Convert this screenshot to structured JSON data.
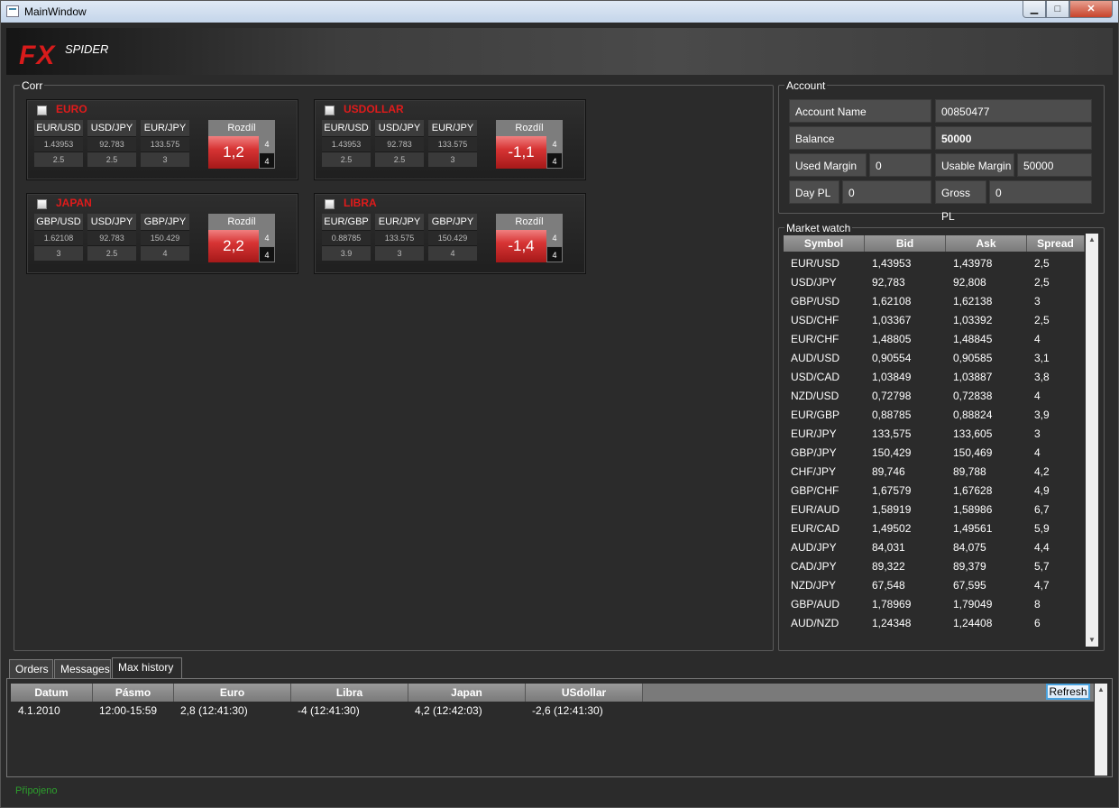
{
  "window": {
    "title": "MainWindow",
    "min_glyph": "▁",
    "max_glyph": "□",
    "close_glyph": "✕"
  },
  "header": {
    "logo_fx": "FX",
    "logo_spider": "SPIDER"
  },
  "corr": {
    "label": "Corr",
    "rozdil_label": "Rozdíl",
    "cards": [
      {
        "name": "EURO",
        "symbols": [
          "EUR/USD",
          "USD/JPY",
          "EUR/JPY"
        ],
        "values": [
          "1.43953",
          "92.783",
          "133.575"
        ],
        "spreads": [
          "2.5",
          "2.5",
          "3"
        ],
        "diff": "1,2",
        "diff_a": "4",
        "diff_b": "4"
      },
      {
        "name": "USDOLLAR",
        "symbols": [
          "EUR/USD",
          "USD/JPY",
          "EUR/JPY"
        ],
        "values": [
          "1.43953",
          "92.783",
          "133.575"
        ],
        "spreads": [
          "2.5",
          "2.5",
          "3"
        ],
        "diff": "-1,1",
        "diff_a": "4",
        "diff_b": "4"
      },
      {
        "name": "JAPAN",
        "symbols": [
          "GBP/USD",
          "USD/JPY",
          "GBP/JPY"
        ],
        "values": [
          "1.62108",
          "92.783",
          "150.429"
        ],
        "spreads": [
          "3",
          "2.5",
          "4"
        ],
        "diff": "2,2",
        "diff_a": "4",
        "diff_b": "4"
      },
      {
        "name": "LIBRA",
        "symbols": [
          "EUR/GBP",
          "EUR/JPY",
          "GBP/JPY"
        ],
        "values": [
          "0.88785",
          "133.575",
          "150.429"
        ],
        "spreads": [
          "3.9",
          "3",
          "4"
        ],
        "diff": "-1,4",
        "diff_a": "4",
        "diff_b": "4"
      }
    ]
  },
  "account": {
    "label": "Account",
    "name_label": "Account Name",
    "name_value": "00850477",
    "balance_label": "Balance",
    "balance_value": "50000",
    "used_margin_label": "Used Margin",
    "used_margin_value": "0",
    "usable_margin_label": "Usable Margin",
    "usable_margin_value": "50000",
    "day_pl_label": "Day PL",
    "day_pl_value": "0",
    "gross_pl_label": "Gross PL",
    "gross_pl_value": "0"
  },
  "market_watch": {
    "label": "Market watch",
    "columns": [
      "Symbol",
      "Bid",
      "Ask",
      "Spread"
    ],
    "rows": [
      [
        "EUR/USD",
        "1,43953",
        "1,43978",
        "2,5"
      ],
      [
        "USD/JPY",
        "92,783",
        "92,808",
        "2,5"
      ],
      [
        "GBP/USD",
        "1,62108",
        "1,62138",
        "3"
      ],
      [
        "USD/CHF",
        "1,03367",
        "1,03392",
        "2,5"
      ],
      [
        "EUR/CHF",
        "1,48805",
        "1,48845",
        "4"
      ],
      [
        "AUD/USD",
        "0,90554",
        "0,90585",
        "3,1"
      ],
      [
        "USD/CAD",
        "1,03849",
        "1,03887",
        "3,8"
      ],
      [
        "NZD/USD",
        "0,72798",
        "0,72838",
        "4"
      ],
      [
        "EUR/GBP",
        "0,88785",
        "0,88824",
        "3,9"
      ],
      [
        "EUR/JPY",
        "133,575",
        "133,605",
        "3"
      ],
      [
        "GBP/JPY",
        "150,429",
        "150,469",
        "4"
      ],
      [
        "CHF/JPY",
        "89,746",
        "89,788",
        "4,2"
      ],
      [
        "GBP/CHF",
        "1,67579",
        "1,67628",
        "4,9"
      ],
      [
        "EUR/AUD",
        "1,58919",
        "1,58986",
        "6,7"
      ],
      [
        "EUR/CAD",
        "1,49502",
        "1,49561",
        "5,9"
      ],
      [
        "AUD/JPY",
        "84,031",
        "84,075",
        "4,4"
      ],
      [
        "CAD/JPY",
        "89,322",
        "89,379",
        "5,7"
      ],
      [
        "NZD/JPY",
        "67,548",
        "67,595",
        "4,7"
      ],
      [
        "GBP/AUD",
        "1,78969",
        "1,79049",
        "8"
      ],
      [
        "AUD/NZD",
        "1,24348",
        "1,24408",
        "6"
      ]
    ]
  },
  "tabs": [
    "Orders",
    "Messages",
    "Max history"
  ],
  "history": {
    "columns": [
      "Datum",
      "Pásmo",
      "Euro",
      "Libra",
      "Japan",
      "USdollar"
    ],
    "rows": [
      [
        "4.1.2010",
        "12:00-15:59",
        "2,8 (12:41:30)",
        "-4 (12:41:30)",
        "4,2 (12:42:03)",
        "-2,6 (12:41:30)"
      ]
    ],
    "refresh_label": "Refresh"
  },
  "status": {
    "text": "Připojeno"
  }
}
